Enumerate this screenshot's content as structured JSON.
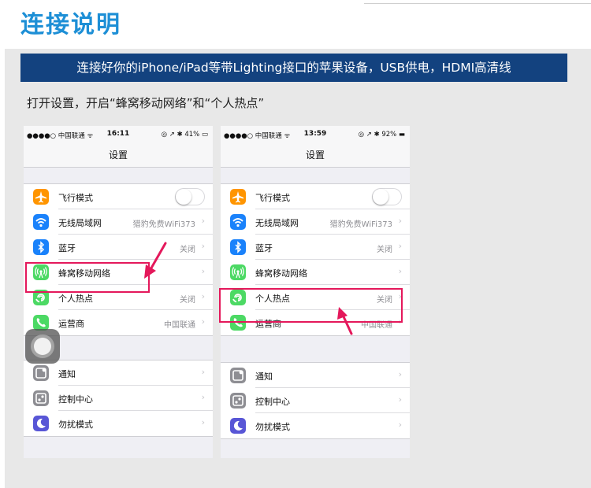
{
  "page": {
    "title": "连接说明",
    "banner": "连接好你的iPhone/iPad等带Lighting接口的苹果设备，USB供电，HDMI高清线",
    "instruction": "打开设置，开启“蜂窝移动网络”和“个人热点”"
  },
  "colors": {
    "title": "#1d8fd6",
    "banner_bg": "#13427f",
    "highlight": "#e4185b"
  },
  "phones": [
    {
      "status": {
        "carrier": "●●●●○ 中国联通 ᯤ",
        "time": "16:11",
        "right": "◎ ↗ ✱ 41% ▭"
      },
      "nav_title": "设置",
      "group1": [
        {
          "icon": "airplane-icon",
          "color": "#ff9500",
          "label": "飞行模式",
          "value": "",
          "toggle": true
        },
        {
          "icon": "wifi-icon",
          "color": "#1a82fb",
          "label": "无线局域网",
          "value": "猎豹免费WiFi373",
          "toggle": false
        },
        {
          "icon": "bluetooth-icon",
          "color": "#1a82fb",
          "label": "蓝牙",
          "value": "关闭",
          "toggle": false
        },
        {
          "icon": "cellular-icon",
          "color": "#4cd964",
          "label": "蜂窝移动网络",
          "value": "",
          "toggle": false
        },
        {
          "icon": "hotspot-icon",
          "color": "#4cd964",
          "label": "个人热点",
          "value": "关闭",
          "toggle": false
        },
        {
          "icon": "phone-icon",
          "color": "#4cd964",
          "label": "运营商",
          "value": "中国联通",
          "toggle": false
        }
      ],
      "group2": [
        {
          "icon": "notification-icon",
          "color": "#8e8e93",
          "label": "通知",
          "value": ""
        },
        {
          "icon": "control-center-icon",
          "color": "#8e8e93",
          "label": "控制中心",
          "value": ""
        },
        {
          "icon": "moon-icon",
          "color": "#5856d6",
          "label": "勿扰模式",
          "value": ""
        }
      ]
    },
    {
      "status": {
        "carrier": "●●●●○ 中国联通 ᯤ",
        "time": "13:59",
        "right": "◎ ↗ ✱ 92% ▬"
      },
      "nav_title": "设置",
      "group1": [
        {
          "icon": "airplane-icon",
          "color": "#ff9500",
          "label": "飞行模式",
          "value": "",
          "toggle": true
        },
        {
          "icon": "wifi-icon",
          "color": "#1a82fb",
          "label": "无线局域网",
          "value": "猎豹免费WiFi373",
          "toggle": false
        },
        {
          "icon": "bluetooth-icon",
          "color": "#1a82fb",
          "label": "蓝牙",
          "value": "关闭",
          "toggle": false
        },
        {
          "icon": "cellular-icon",
          "color": "#4cd964",
          "label": "蜂窝移动网络",
          "value": "",
          "toggle": false
        },
        {
          "icon": "hotspot-icon",
          "color": "#4cd964",
          "label": "个人热点",
          "value": "关闭",
          "toggle": false
        },
        {
          "icon": "phone-icon",
          "color": "#4cd964",
          "label": "运营商",
          "value": "中国联通",
          "toggle": false
        }
      ],
      "group2": [
        {
          "icon": "notification-icon",
          "color": "#8e8e93",
          "label": "通知",
          "value": ""
        },
        {
          "icon": "control-center-icon",
          "color": "#8e8e93",
          "label": "控制中心",
          "value": ""
        },
        {
          "icon": "moon-icon",
          "color": "#5856d6",
          "label": "勿扰模式",
          "value": ""
        }
      ]
    }
  ]
}
